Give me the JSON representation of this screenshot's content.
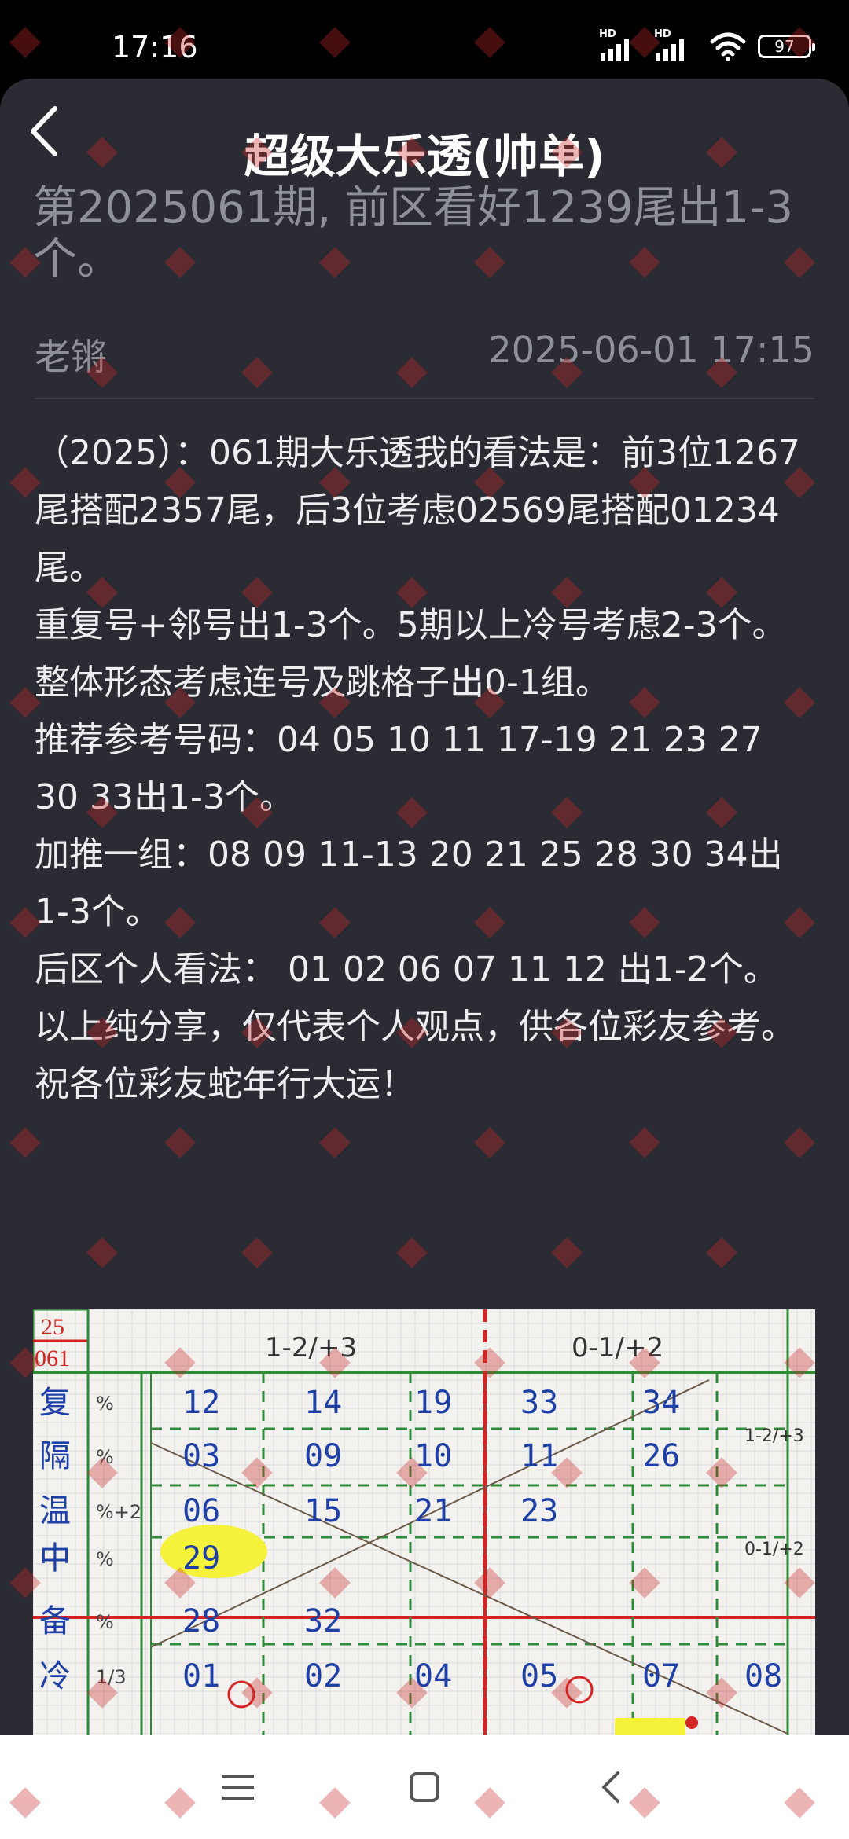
{
  "status": {
    "time": "17:16",
    "battery": "97",
    "hd1": "HD",
    "hd2": "HD"
  },
  "nav": {
    "title": "超级大乐透(帅单)"
  },
  "article": {
    "title": "第2025061期, 前区看好1239尾出1-3个。",
    "author": "老锵",
    "datetime": "2025-06-01 17:15",
    "paragraphs": [
      "（2025）：061期大乐透我的看法是：前3位1267尾搭配2357尾，后3位考虑02569尾搭配01234尾。",
      "重复号+邻号出1-3个。5期以上冷号考虑2-3个。",
      "整体形态考虑连号及跳格子出0-1组。",
      "推荐参考号码：04 05 10 11 17-19 21 23 27 30 33出1-3个。",
      "加推一组：08 09 11-13 20 21 25 28 30 34出1-3个。",
      "后区个人看法： 01 02 06 07 11 12 出1-2个。",
      "以上纯分享，仅代表个人观点，供各位彩友参考。",
      "祝各位彩友蛇年行大运！"
    ]
  },
  "sheet": {
    "year": "25",
    "issue": "061",
    "head_left": "1-2/+3",
    "head_right": "0-1/+2",
    "row_labels": [
      "复",
      "隔",
      "温",
      "中",
      "备",
      "冷"
    ],
    "row_fracs": [
      "%",
      "%",
      "%+2",
      "%",
      "%",
      "1/3"
    ],
    "rows": [
      [
        "12",
        "14",
        "19",
        "33",
        "34"
      ],
      [
        "03",
        "09",
        "10",
        "11",
        "26"
      ],
      [
        "06",
        "15",
        "21",
        "23",
        ""
      ],
      [
        "29",
        "",
        "",
        "",
        ""
      ],
      [
        "28",
        "32",
        "",
        "",
        ""
      ],
      [
        "01",
        "02",
        "04",
        "05",
        "07",
        "08"
      ]
    ],
    "side_notes": [
      "1-2/+3",
      "0-1/+2"
    ]
  },
  "colors": {
    "panel": "#2b2c33",
    "text": "#eeeef0",
    "muted": "#8e9097",
    "ink_blue": "#1d3fa6",
    "grid_green": "#2f8a3a",
    "grid_red": "#d42424",
    "highlight": "#f4f23a"
  }
}
